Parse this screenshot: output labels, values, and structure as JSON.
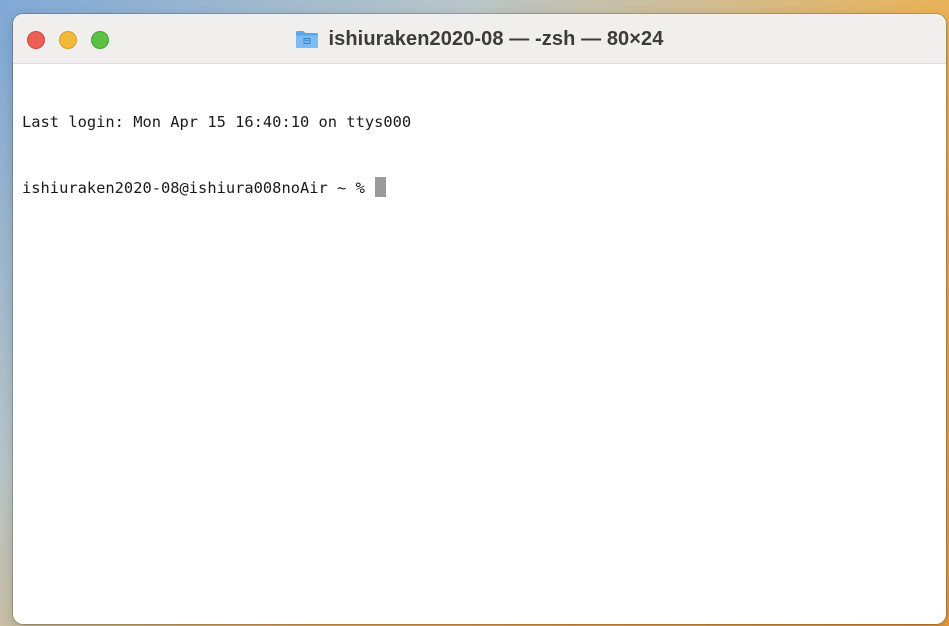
{
  "window": {
    "title": "ishiuraken2020-08 — -zsh — 80×24",
    "title_icon": "folder-icon",
    "traffic_lights": {
      "close_color": "#ec5f57",
      "minimize_color": "#f2b93a",
      "zoom_color": "#5cc045"
    }
  },
  "terminal": {
    "lines": [
      "Last login: Mon Apr 15 16:40:10 on ttys000"
    ],
    "prompt": "ishiuraken2020-08@ishiura008noAir ~ % "
  }
}
